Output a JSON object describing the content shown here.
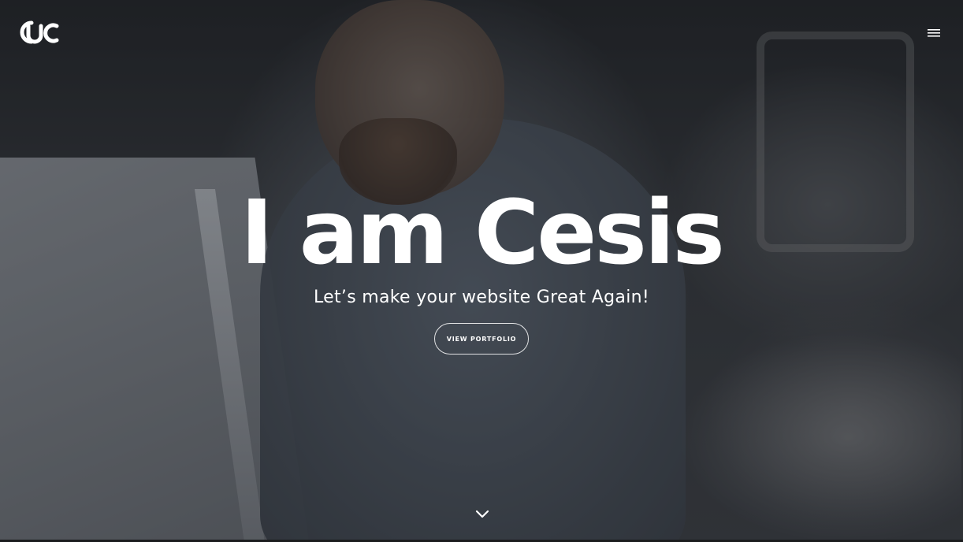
{
  "header": {
    "logo_icon": "cesis-logo-icon",
    "menu_icon": "hamburger-menu-icon"
  },
  "hero": {
    "headline": "I am Cesis",
    "tagline": "Let’s make your website Great Again!",
    "cta_label": "VIEW PORTFOLIO",
    "scroll_icon": "chevron-down-icon"
  },
  "colors": {
    "text": "#ffffff",
    "overlay": "#2a2c30"
  }
}
